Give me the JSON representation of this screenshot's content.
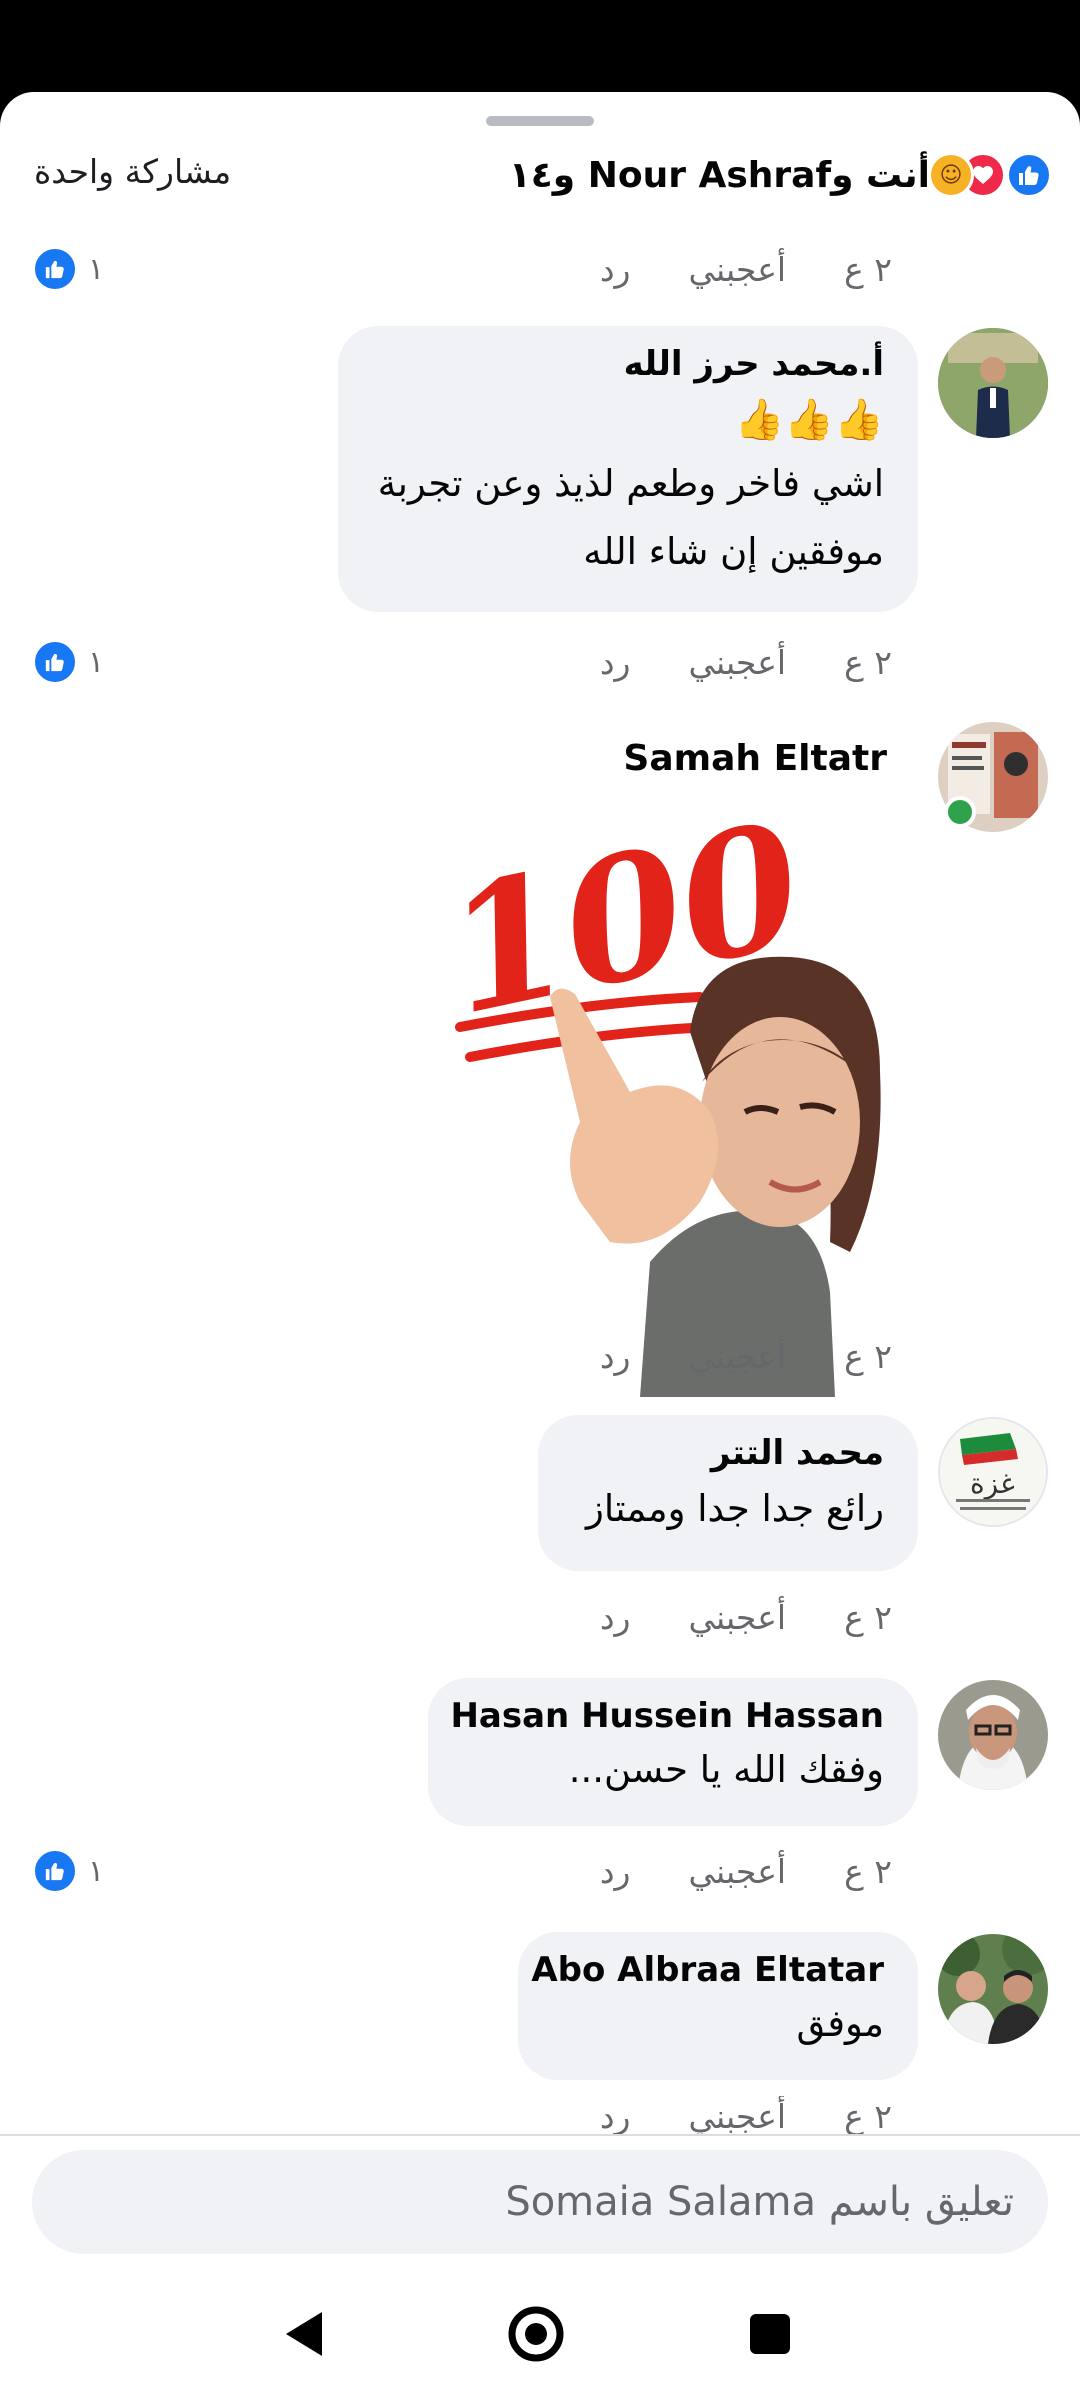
{
  "header": {
    "share_count": "مشاركة واحدة",
    "reactors": "أنت وNour Ashraf و١٤"
  },
  "comments": [
    {
      "time": "٢ ع",
      "like": "أعجبني",
      "reply": "رد",
      "reactions": "١"
    },
    {
      "author": "أ.محمد حرز الله",
      "emoji": "👍👍👍",
      "text": "اشي فاخر وطعم لذيذ وعن تجربة موفقين إن شاء الله",
      "time": "٢ ع",
      "like": "أعجبني",
      "reply": "رد",
      "reactions": "١"
    },
    {
      "author": "Samah Eltatr",
      "sticker_text": "100",
      "time": "٢ ع",
      "like": "أعجبني",
      "reply": "رد"
    },
    {
      "author": "محمد التتر",
      "text": "رائع جدا جدا وممتاز",
      "time": "٢ ع",
      "like": "أعجبني",
      "reply": "رد"
    },
    {
      "author": "Hasan Hussein Hassan",
      "text": "وفقك الله يا حسن...",
      "time": "٢ ع",
      "like": "أعجبني",
      "reply": "رد",
      "reactions": "١"
    },
    {
      "author": "Abo Albraa Eltatar",
      "text": "موفق",
      "time": "٢ ع",
      "like": "أعجبني",
      "reply": "رد"
    }
  ],
  "composer": {
    "placeholder": "تعليق باسم Somaia Salama"
  },
  "colors": {
    "accent": "#1877f2",
    "bubble": "#f0f2f5",
    "online": "#31a24c"
  },
  "icons": [
    "like-icon",
    "love-icon",
    "care-icon",
    "back-nav-icon",
    "home-nav-icon",
    "recents-nav-icon"
  ]
}
